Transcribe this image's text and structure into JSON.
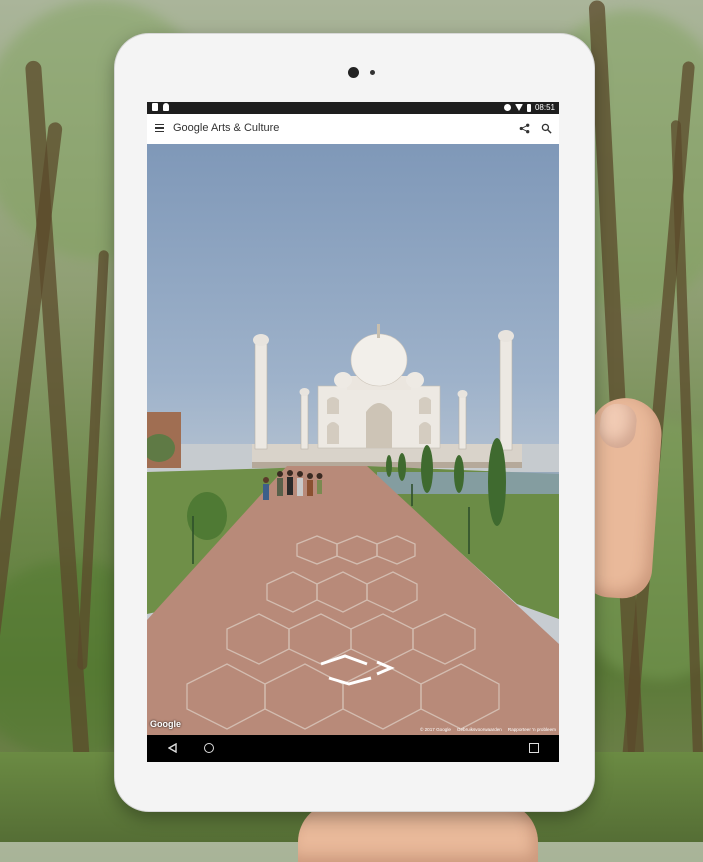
{
  "status_bar": {
    "time": "08:51",
    "icons": [
      "notification-icon",
      "android-icon",
      "do-not-disturb-icon",
      "wifi-icon",
      "battery-icon"
    ]
  },
  "app_bar": {
    "title_google": "Google",
    "title_rest": "Arts & Culture",
    "icons": [
      "menu-icon",
      "share-icon",
      "search-icon"
    ]
  },
  "street_view": {
    "google_watermark": "Google",
    "attribution": {
      "copyright": "© 2017 Google",
      "terms": "Gebruiksvoorwaarden",
      "report": "Rapporteer 'n probleem"
    }
  },
  "nav_bar": {
    "icons": [
      "back-icon",
      "home-icon",
      "recent-apps-icon"
    ]
  },
  "colors": {
    "status_bar": "#1e1e1e",
    "app_bar": "#ffffff",
    "nav_bar": "#000000",
    "tablet_frame": "#f4f4f4"
  }
}
